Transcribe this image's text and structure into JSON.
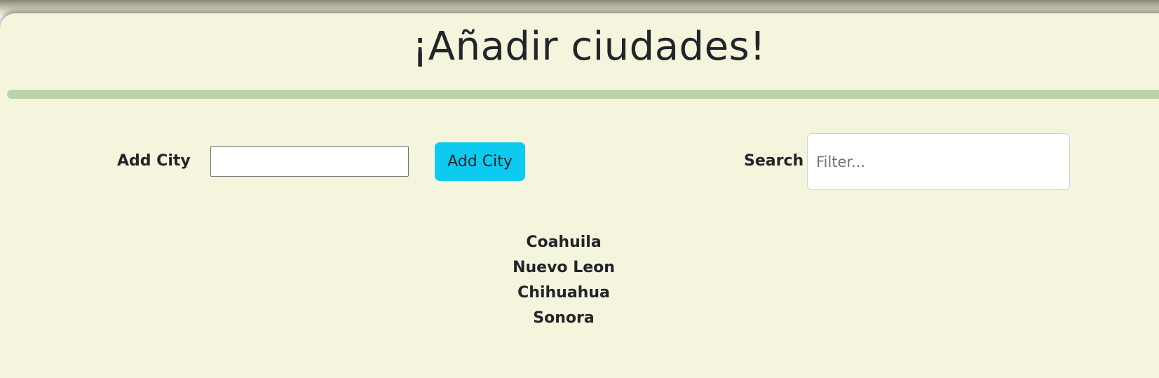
{
  "header": {
    "title": "¡Añadir ciudades!"
  },
  "add_city": {
    "label": "Add City",
    "input_value": "",
    "button_label": "Add City",
    "button_color": "#0dcaf0"
  },
  "search": {
    "label": "Search",
    "placeholder": "Filter..."
  },
  "cities": [
    {
      "name": "Coahuila"
    },
    {
      "name": "Nuevo Leon"
    },
    {
      "name": "Chihuahua"
    },
    {
      "name": "Sonora"
    }
  ],
  "colors": {
    "background": "#f5f4dc",
    "divider": "#bcd3a9",
    "text": "#212529"
  }
}
